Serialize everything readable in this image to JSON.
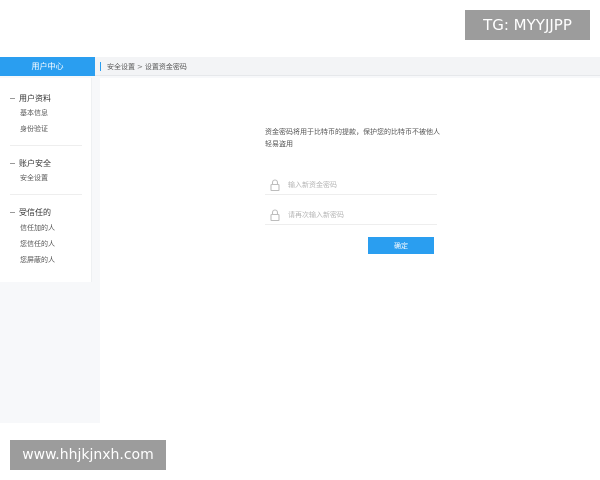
{
  "watermarks": {
    "top": "TG: MYYJJPP",
    "bottom": "www.hhjkjnxh.com"
  },
  "header": {
    "user_center": "用户中心",
    "breadcrumb": [
      "安全设置",
      ">",
      "设置资金密码"
    ]
  },
  "sidebar": {
    "groups": [
      {
        "title": "用户资料",
        "items": [
          "基本信息",
          "身份验证"
        ]
      },
      {
        "title": "账户安全",
        "items": [
          "安全设置"
        ]
      },
      {
        "title": "受信任的",
        "items": [
          "信任加的人",
          "您信任的人",
          "您屏蔽的人"
        ]
      }
    ]
  },
  "form": {
    "description": "资金密码将用于比特币的提款，保护您的比特币不被他人轻易盗用",
    "new_password_placeholder": "输入新资金密码",
    "confirm_password_placeholder": "请再次输入新密码",
    "confirm_label": "确定"
  },
  "colors": {
    "accent": "#2a9ef0",
    "watermark_bg": "#9c9c9c"
  },
  "icons": {
    "field": "lock-icon",
    "group_toggle": "minus-icon"
  }
}
